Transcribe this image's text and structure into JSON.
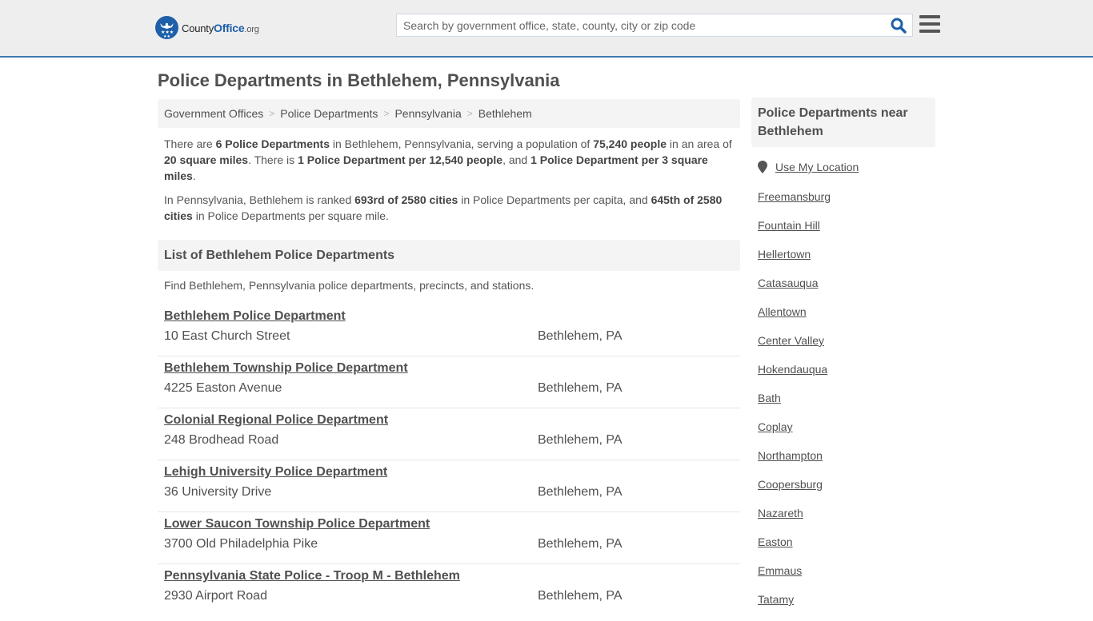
{
  "header": {
    "logo": {
      "brand_prefix": "County",
      "brand_main": "Office",
      "brand_suffix": ".org"
    },
    "search": {
      "placeholder": "Search by government office, state, county, city or zip code",
      "value": ""
    },
    "icons": {
      "search": "search-icon",
      "menu": "hamburger-menu-icon"
    }
  },
  "colors": {
    "accent": "#1d5fa8",
    "header_border": "#3c7ab0",
    "header_bg": "#eeeeee",
    "panel_bg": "#f4f4f4",
    "text": "#505050"
  },
  "page": {
    "title": "Police Departments in Bethlehem, Pennsylvania"
  },
  "breadcrumb": [
    {
      "label": "Government Offices"
    },
    {
      "label": "Police Departments"
    },
    {
      "label": "Pennsylvania"
    },
    {
      "label": "Bethlehem"
    }
  ],
  "breadcrumb_separator": ">",
  "intro": {
    "p1": [
      {
        "t": "There are ",
        "b": false
      },
      {
        "t": "6 Police Departments",
        "b": true
      },
      {
        "t": " in Bethlehem, Pennsylvania, serving a population of ",
        "b": false
      },
      {
        "t": "75,240 people",
        "b": true
      },
      {
        "t": " in an area of ",
        "b": false
      },
      {
        "t": "20 square miles",
        "b": true
      },
      {
        "t": ". There is ",
        "b": false
      },
      {
        "t": "1 Police Department per 12,540 people",
        "b": true
      },
      {
        "t": ", and ",
        "b": false
      },
      {
        "t": "1 Police Department per 3 square miles",
        "b": true
      },
      {
        "t": ".",
        "b": false
      }
    ],
    "p2": [
      {
        "t": "In Pennsylvania, Bethlehem is ranked ",
        "b": false
      },
      {
        "t": "693rd of 2580 cities",
        "b": true
      },
      {
        "t": " in Police Departments per capita, and ",
        "b": false
      },
      {
        "t": "645th of 2580 cities",
        "b": true
      },
      {
        "t": " in Police Departments per square mile.",
        "b": false
      }
    ]
  },
  "list": {
    "title": "List of Bethlehem Police Departments",
    "description": "Find Bethlehem, Pennsylvania police departments, precincts, and stations.",
    "items": [
      {
        "name": "Bethlehem Police Department",
        "address": "10 East Church Street",
        "city": "Bethlehem, PA"
      },
      {
        "name": "Bethlehem Township Police Department",
        "address": "4225 Easton Avenue",
        "city": "Bethlehem, PA"
      },
      {
        "name": "Colonial Regional Police Department",
        "address": "248 Brodhead Road",
        "city": "Bethlehem, PA"
      },
      {
        "name": "Lehigh University Police Department",
        "address": "36 University Drive",
        "city": "Bethlehem, PA"
      },
      {
        "name": "Lower Saucon Township Police Department",
        "address": "3700 Old Philadelphia Pike",
        "city": "Bethlehem, PA"
      },
      {
        "name": "Pennsylvania State Police - Troop M - Bethlehem",
        "address": "2930 Airport Road",
        "city": "Bethlehem, PA"
      }
    ]
  },
  "sidebar": {
    "title": "Police Departments near Bethlehem",
    "use_location": "Use My Location",
    "nearby": [
      "Freemansburg",
      "Fountain Hill",
      "Hellertown",
      "Catasauqua",
      "Allentown",
      "Center Valley",
      "Hokendauqua",
      "Bath",
      "Coplay",
      "Northampton",
      "Coopersburg",
      "Nazareth",
      "Easton",
      "Emmaus",
      "Tatamy"
    ]
  }
}
